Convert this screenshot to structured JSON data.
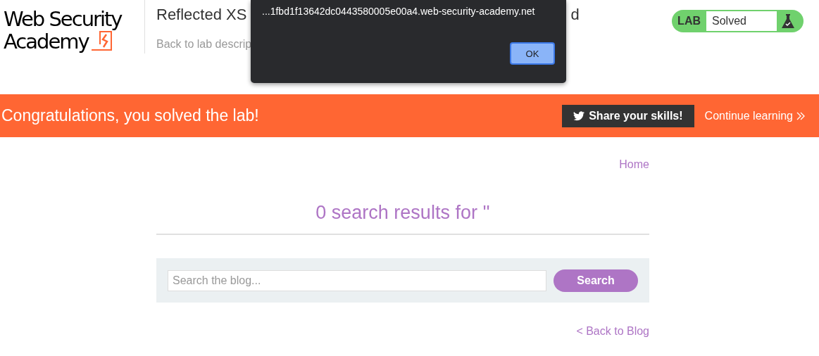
{
  "header": {
    "logo": {
      "line_1": "Web Security",
      "line_2": "Academy"
    },
    "title": {
      "start": "Reflected XS",
      "end": "d"
    },
    "back_link": "Back to lab descrip",
    "lab_status": {
      "label": "LAB",
      "status": "Solved",
      "solved": true
    }
  },
  "dialog": {
    "message": "...1fbd1f13642dc0443580005e00a4.web-security-academy.net",
    "ok_button": "OK"
  },
  "banner": {
    "message": "Congratulations, you solved the lab!",
    "share_button": "Share your skills!",
    "continue_link": "Continue learning"
  },
  "nav": {
    "home_link": "Home"
  },
  "results_heading": "0 search results for ''",
  "search": {
    "placeholder": "Search the blog...",
    "button": "Search"
  },
  "back_to_blog": "< Back to Blog"
}
